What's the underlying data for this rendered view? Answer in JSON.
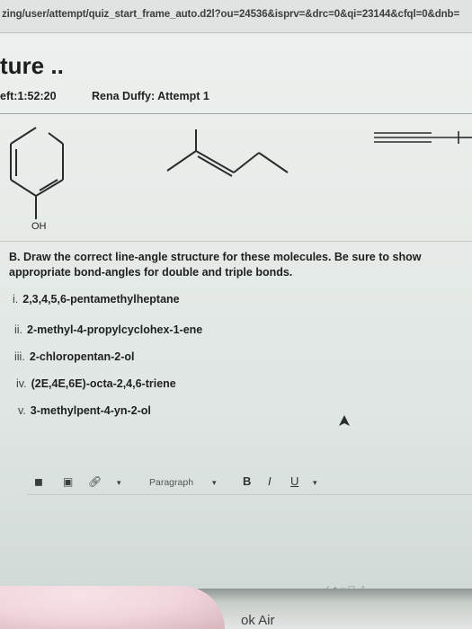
{
  "browser": {
    "url": "zing/user/attempt/quiz_start_frame_auto.d2l?ou=24536&isprv=&drc=0&qi=23144&cfql=0&dnb="
  },
  "quiz": {
    "title": "ture ..",
    "time_left": "eft:1:52:20",
    "attempt": "Rena Duffy: Attempt 1"
  },
  "structures": {
    "oh_label": "OH"
  },
  "question": {
    "instruction": "B. Draw the correct line-angle structure for these molecules. Be sure to show appropriate bond-angles for double and triple bonds.",
    "items": [
      {
        "num": "i.",
        "text": "2,3,4,5,6-pentamethylheptane"
      },
      {
        "num": "ii.",
        "text": "2-methyl-4-propylcyclohex-1-ene"
      },
      {
        "num": "iii.",
        "text": "2-chloropentan-2-ol"
      },
      {
        "num": "iv.",
        "text": "(2E,4E,6E)-octa-2,4,6-triene"
      },
      {
        "num": "v.",
        "text": "3-methylpent-4-yn-2-ol"
      }
    ]
  },
  "editor": {
    "toolbar": {
      "paragraph_label": "Paragraph",
      "bold": "B",
      "italic": "I",
      "underline": "U"
    }
  },
  "device": {
    "label": "ok Air"
  }
}
